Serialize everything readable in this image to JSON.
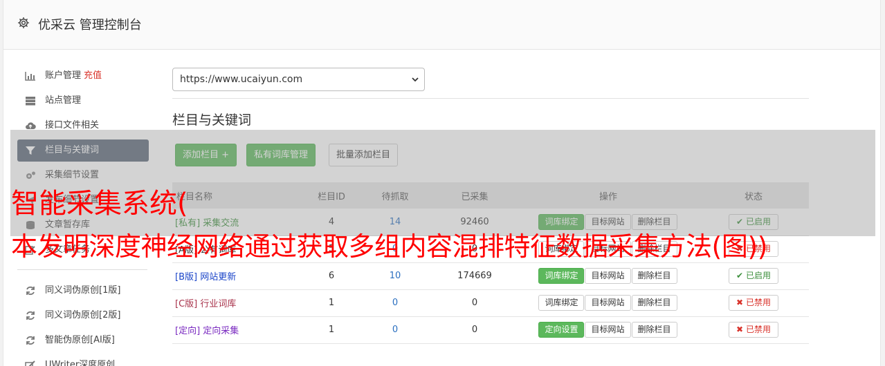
{
  "header": {
    "title": "优采云 管理控制台",
    "icon": "gear-icon"
  },
  "sidebar": {
    "items": [
      {
        "label": "账户管理",
        "badge": "充值",
        "icon": "bar-chart-icon"
      },
      {
        "label": "站点管理",
        "icon": "server-icon"
      },
      {
        "label": "接口文件相关",
        "icon": "cloud-upload-icon"
      },
      {
        "label": "栏目与关键词",
        "icon": "filter-icon",
        "active": true
      },
      {
        "label": "采集细节设置",
        "icon": "cogs-icon"
      },
      {
        "label": "发布细节设置",
        "icon": "send-icon"
      },
      {
        "label": "文章暂存库",
        "icon": "database-icon"
      },
      {
        "label": "多文章任务",
        "icon": "edit-icon"
      }
    ],
    "tools": [
      {
        "label": "同义词伪原创[1版]",
        "icon": "refresh-icon"
      },
      {
        "label": "同义词伪原创[2版]",
        "icon": "refresh-icon"
      },
      {
        "label": "智能伪原创[AI版]",
        "icon": "refresh-icon"
      },
      {
        "label": "UWriter深度原创",
        "icon": "pencil-icon"
      }
    ]
  },
  "site_select": {
    "value": "https://www.ucaiyun.com"
  },
  "section": {
    "title": "栏目与关键词"
  },
  "actions": {
    "add_column": "添加栏目 +",
    "private_lib": "私有词库管理",
    "batch_add": "批量添加栏目"
  },
  "table": {
    "headers": {
      "name": "栏目名称",
      "id": "栏目ID",
      "pending": "待抓取",
      "collected": "已采集",
      "ops": "操作",
      "status": "状态"
    },
    "rows": [
      {
        "tag": "[私有]",
        "name": "采集交流",
        "id": "4",
        "pending": "14",
        "collected": "92460",
        "op1": "词库绑定",
        "op1_green": true,
        "op2": "目标网站",
        "op3": "删除栏目",
        "status": "已启用",
        "on": true,
        "color": "#3c8f3c"
      },
      {
        "tag": "[A版]",
        "name": "公有词库",
        "id": "5",
        "pending": "0",
        "collected": "0",
        "op1": "词库绑定",
        "op1_green": false,
        "op2": "目标网站",
        "op3": "删除栏目",
        "status": "已禁用",
        "on": false,
        "color": "#333333"
      },
      {
        "tag": "[B版]",
        "name": "网站更新",
        "id": "6",
        "pending": "10",
        "collected": "174669",
        "op1": "词库绑定",
        "op1_green": true,
        "op2": "目标网站",
        "op3": "删除栏目",
        "status": "已启用",
        "on": true,
        "color": "#1a44c8"
      },
      {
        "tag": "[C版]",
        "name": "行业词库",
        "id": "1",
        "pending": "0",
        "collected": "0",
        "op1": "词库绑定",
        "op1_green": false,
        "op2": "目标网站",
        "op3": "删除栏目",
        "status": "已禁用",
        "on": false,
        "color": "#a8324a"
      },
      {
        "tag": "[定向]",
        "name": "定向采集",
        "id": "1",
        "pending": "0",
        "collected": "0",
        "op1": "定向设置",
        "op1_green": true,
        "op2": "目标网站",
        "op3": "删除栏目",
        "status": "已禁用",
        "on": false,
        "color": "#7a2ac0"
      }
    ]
  },
  "watermark": {
    "line1": "智能采集系统(",
    "line2": "本发明深度神经网络通过获取多组内容混排特征数据采集方法(图))"
  }
}
